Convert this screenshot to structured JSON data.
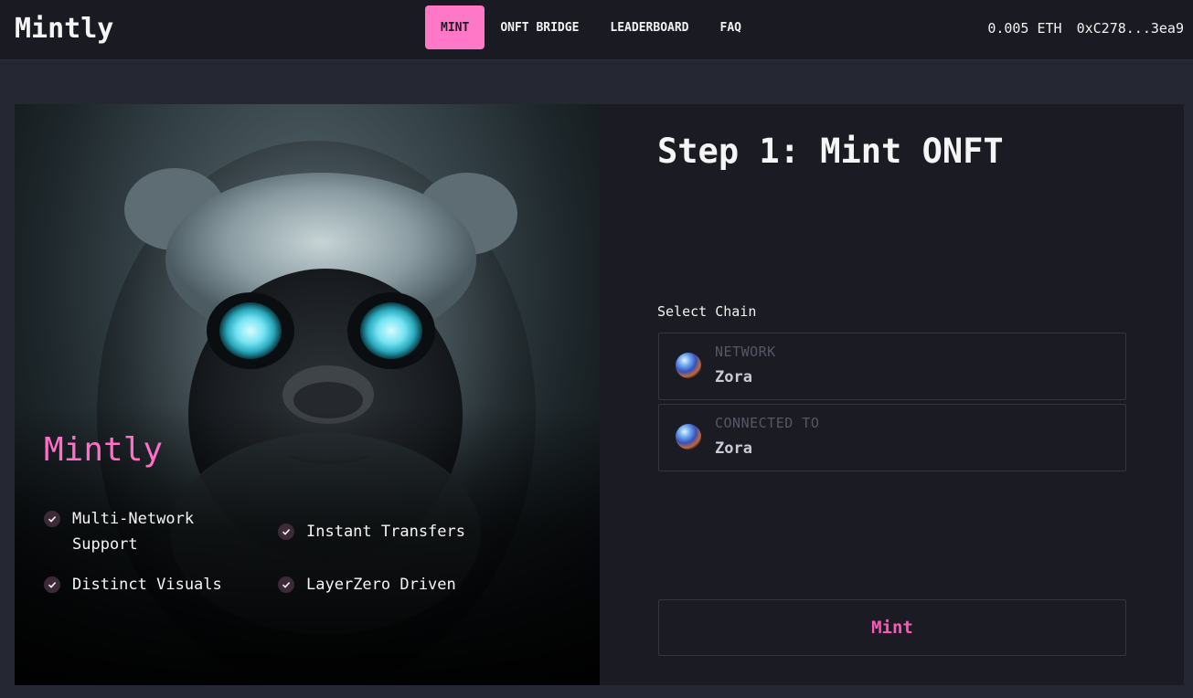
{
  "header": {
    "brand": "Mintly",
    "nav": [
      {
        "label": "MINT",
        "active": true
      },
      {
        "label": "ONFT BRIDGE",
        "active": false
      },
      {
        "label": "LEADERBOARD",
        "active": false
      },
      {
        "label": "FAQ",
        "active": false
      }
    ],
    "balance": "0.005 ETH",
    "address": "0xC278...3ea9"
  },
  "hero": {
    "title": "Mintly",
    "image_icon": "furry-creature-glowing-eyes-image",
    "features": [
      {
        "line1": "Multi-Network",
        "line2": "Support"
      },
      {
        "line1": "Instant Transfers",
        "line2": ""
      },
      {
        "line1": "Distinct Visuals",
        "line2": ""
      },
      {
        "line1": "LayerZero Driven",
        "line2": ""
      }
    ]
  },
  "panel": {
    "step_title": "Step 1: Mint ONFT",
    "select_label": "Select Chain",
    "network": {
      "caption": "NETWORK",
      "value": "Zora",
      "icon": "zora-globe-icon"
    },
    "connected": {
      "caption": "CONNECTED TO",
      "value": "Zora",
      "icon": "zora-globe-icon"
    },
    "mint_label": "Mint"
  },
  "colors": {
    "accent_pink": "#ff78c8",
    "mint_text": "#ff57b9",
    "background": "#252733",
    "card": "#1b1c23"
  }
}
